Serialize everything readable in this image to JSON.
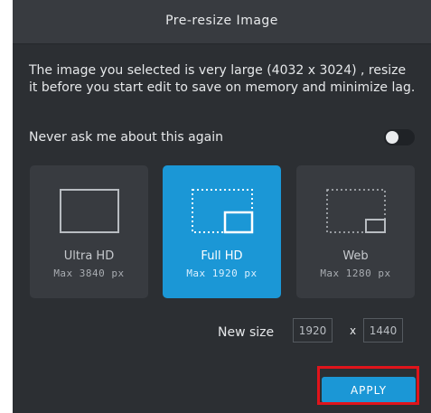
{
  "dialog": {
    "title": "Pre-resize Image",
    "message": "The image you selected is very large (4032 x 3024) , resize it before you start edit to save on memory and minimize lag.",
    "never_ask_label": "Never ask me about this again",
    "never_ask_enabled": false
  },
  "options": [
    {
      "name": "Ultra HD",
      "max": "Max 3840 px",
      "icon": "ultra-hd-icon",
      "selected": false
    },
    {
      "name": "Full HD",
      "max": "Max 1920 px",
      "icon": "full-hd-icon",
      "selected": true
    },
    {
      "name": "Web",
      "max": "Max 1280 px",
      "icon": "web-size-icon",
      "selected": false
    }
  ],
  "new_size": {
    "label": "New size",
    "width": "1920",
    "separator": "x",
    "height": "1440"
  },
  "apply_label": "APPLY",
  "colors": {
    "dialog_bg": "#2c2f33",
    "header_bg": "#383b40",
    "card_bg": "#383b40",
    "accent": "#1b97d6",
    "highlight": "#e0141b"
  }
}
